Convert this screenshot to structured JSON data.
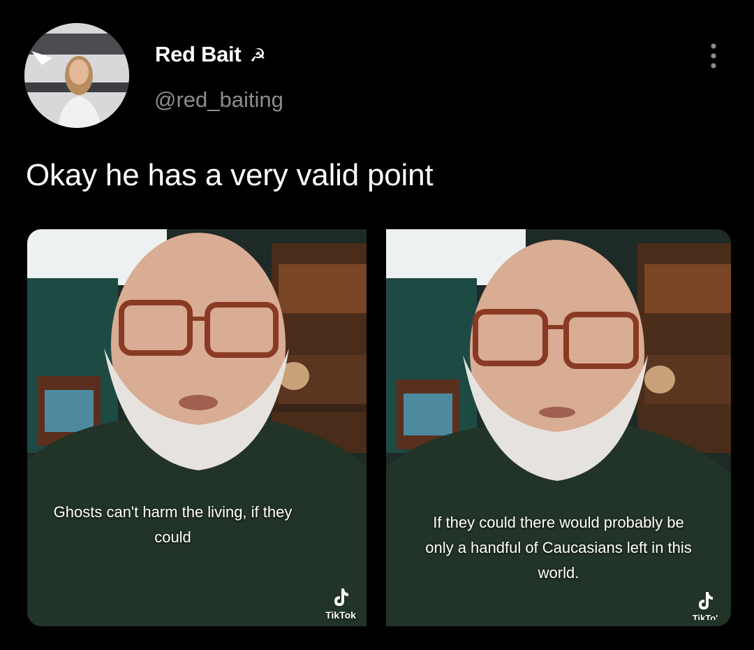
{
  "header": {
    "display_name": "Red Bait",
    "name_emoji": "☭",
    "handle": "@red_baiting"
  },
  "tweet": {
    "text": "Okay he has a very valid point"
  },
  "media": [
    {
      "caption": "Ghosts can't harm the living, if they could",
      "watermark": "TikTok"
    },
    {
      "caption": "If they could there would probably be only a handful of Caucasians left in this world.",
      "watermark": "TikTo'"
    }
  ],
  "icons": {
    "more": "more-vertical-icon",
    "tiktok": "tiktok-logo-icon"
  },
  "colors": {
    "background": "#000000",
    "handle": "#8a8d91",
    "text": "#ffffff"
  }
}
